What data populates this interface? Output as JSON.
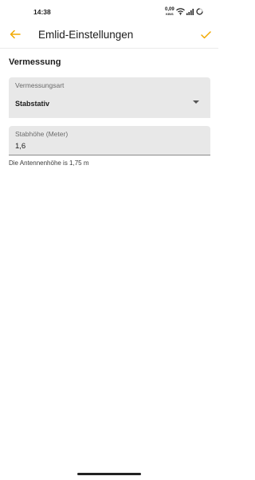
{
  "status_bar": {
    "time": "14:38",
    "net_speed_value": "0,09",
    "net_speed_unit": "KB/S",
    "icons": [
      "wifi-icon",
      "signal-icon",
      "battery-icon"
    ]
  },
  "app_bar": {
    "title": "Emlid-Einstellungen",
    "back_icon": "arrow-left-icon",
    "confirm_icon": "checkmark-icon"
  },
  "section": {
    "title": "Vermessung"
  },
  "survey_type": {
    "label": "Vermessungsart",
    "value": "Stabstativ"
  },
  "pole_height": {
    "label": "Stabhöhe (Meter)",
    "value": "1,6",
    "helper": "Die Antennenhöhe is 1,75 m"
  },
  "colors": {
    "accent": "#f2a900",
    "field_bg": "#e8e8e8",
    "text": "#1c1c1c"
  }
}
